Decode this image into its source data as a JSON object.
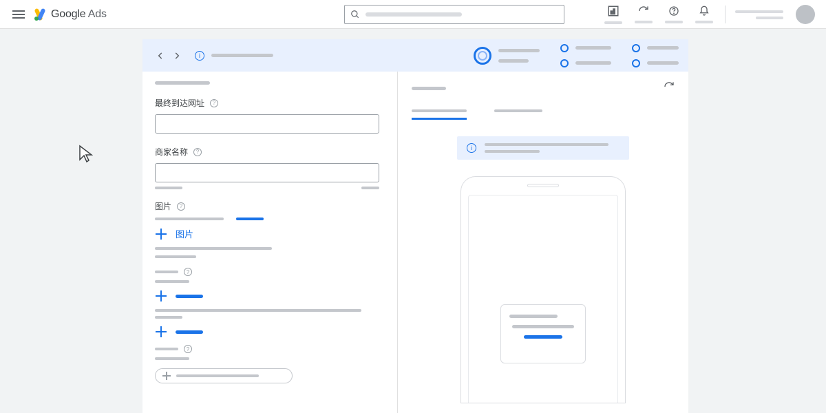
{
  "brand": {
    "name_bold": "Google",
    "name_light": " Ads"
  },
  "form": {
    "final_url_label": "最终到达网址",
    "business_name_label": "商家名称",
    "images_label": "图片",
    "add_images_label": "图片"
  }
}
